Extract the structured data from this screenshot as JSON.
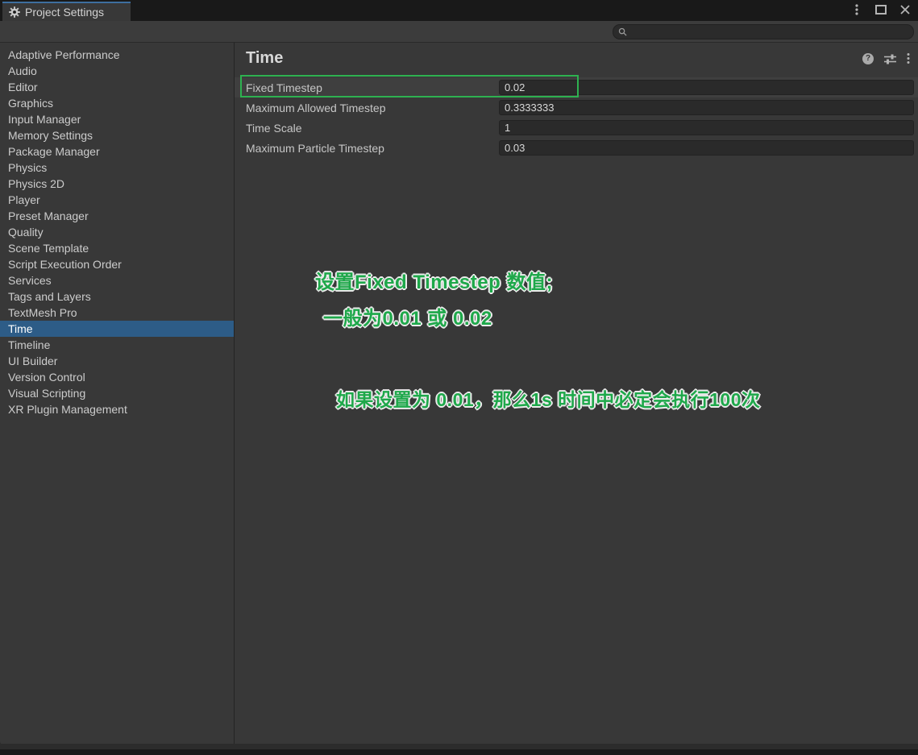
{
  "window": {
    "tab_title": "Project Settings"
  },
  "toolbar": {
    "search_value": "",
    "search_placeholder": ""
  },
  "sidebar": {
    "selected_index": 17,
    "selected_item": "Time",
    "items": [
      "Adaptive Performance",
      "Audio",
      "Editor",
      "Graphics",
      "Input Manager",
      "Memory Settings",
      "Package Manager",
      "Physics",
      "Physics 2D",
      "Player",
      "Preset Manager",
      "Quality",
      "Scene Template",
      "Script Execution Order",
      "Services",
      "Tags and Layers",
      "TextMesh Pro",
      "Time",
      "Timeline",
      "UI Builder",
      "Version Control",
      "Visual Scripting",
      "XR Plugin Management"
    ]
  },
  "main": {
    "title": "Time",
    "help_glyph": "?",
    "fields": [
      {
        "label": "Fixed Timestep",
        "value": "0.02",
        "highlighted": true
      },
      {
        "label": "Maximum Allowed Timestep",
        "value": "0.3333333",
        "highlighted": false
      },
      {
        "label": "Time Scale",
        "value": "1",
        "highlighted": false
      },
      {
        "label": "Maximum Particle Timestep",
        "value": "0.03",
        "highlighted": false
      }
    ]
  },
  "annotations": {
    "lines": [
      {
        "text": "设置Fixed Timestep 数值;"
      },
      {
        "text": "一般为0.01 或 0.02"
      },
      {
        "text": "如果设置为 0.01，那么1s 时间中必定会执行100次"
      }
    ],
    "highlight_box_target": "Fixed Timestep"
  },
  "colors": {
    "selection_blue": "#2d5c87",
    "tab_accent_blue": "#3e6f9f",
    "annotation_green": "#2eb150",
    "panel_bg": "#383838",
    "field_bg": "#2a2a2a",
    "titlebar_bg": "#191919"
  }
}
